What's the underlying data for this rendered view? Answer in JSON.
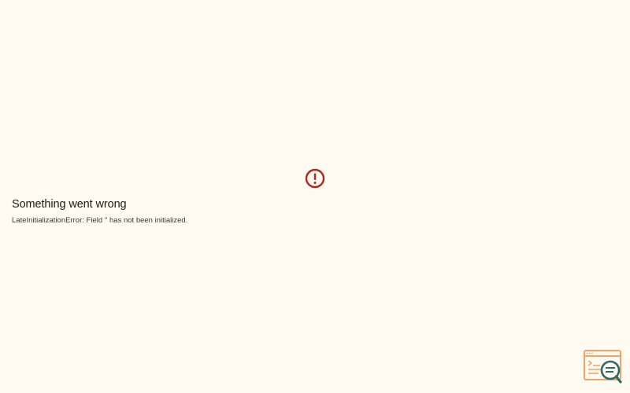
{
  "error": {
    "title": "Something went wrong",
    "message": "LateInitializationError: Field '' has not been initialized.",
    "icon": "error-circle-icon"
  },
  "widget_inspector": {
    "icon": "inspector-search-icon"
  },
  "colors": {
    "background": "#fffbf1",
    "error_red": "#b3261e",
    "inspector_orange": "#f2a36b",
    "inspector_teal": "#2e6b67"
  }
}
